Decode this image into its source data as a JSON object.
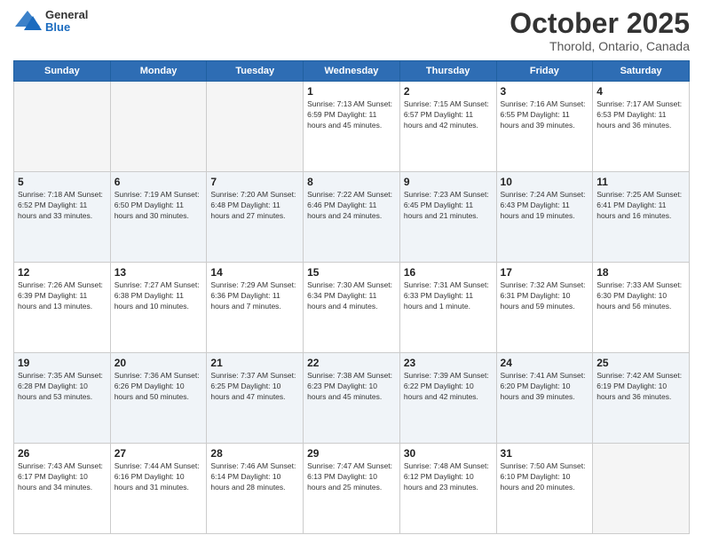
{
  "header": {
    "logo": {
      "general": "General",
      "blue": "Blue"
    },
    "title": "October 2025",
    "location": "Thorold, Ontario, Canada"
  },
  "days_of_week": [
    "Sunday",
    "Monday",
    "Tuesday",
    "Wednesday",
    "Thursday",
    "Friday",
    "Saturday"
  ],
  "weeks": [
    [
      {
        "day": "",
        "info": ""
      },
      {
        "day": "",
        "info": ""
      },
      {
        "day": "",
        "info": ""
      },
      {
        "day": "1",
        "info": "Sunrise: 7:13 AM\nSunset: 6:59 PM\nDaylight: 11 hours and 45 minutes."
      },
      {
        "day": "2",
        "info": "Sunrise: 7:15 AM\nSunset: 6:57 PM\nDaylight: 11 hours and 42 minutes."
      },
      {
        "day": "3",
        "info": "Sunrise: 7:16 AM\nSunset: 6:55 PM\nDaylight: 11 hours and 39 minutes."
      },
      {
        "day": "4",
        "info": "Sunrise: 7:17 AM\nSunset: 6:53 PM\nDaylight: 11 hours and 36 minutes."
      }
    ],
    [
      {
        "day": "5",
        "info": "Sunrise: 7:18 AM\nSunset: 6:52 PM\nDaylight: 11 hours and 33 minutes."
      },
      {
        "day": "6",
        "info": "Sunrise: 7:19 AM\nSunset: 6:50 PM\nDaylight: 11 hours and 30 minutes."
      },
      {
        "day": "7",
        "info": "Sunrise: 7:20 AM\nSunset: 6:48 PM\nDaylight: 11 hours and 27 minutes."
      },
      {
        "day": "8",
        "info": "Sunrise: 7:22 AM\nSunset: 6:46 PM\nDaylight: 11 hours and 24 minutes."
      },
      {
        "day": "9",
        "info": "Sunrise: 7:23 AM\nSunset: 6:45 PM\nDaylight: 11 hours and 21 minutes."
      },
      {
        "day": "10",
        "info": "Sunrise: 7:24 AM\nSunset: 6:43 PM\nDaylight: 11 hours and 19 minutes."
      },
      {
        "day": "11",
        "info": "Sunrise: 7:25 AM\nSunset: 6:41 PM\nDaylight: 11 hours and 16 minutes."
      }
    ],
    [
      {
        "day": "12",
        "info": "Sunrise: 7:26 AM\nSunset: 6:39 PM\nDaylight: 11 hours and 13 minutes."
      },
      {
        "day": "13",
        "info": "Sunrise: 7:27 AM\nSunset: 6:38 PM\nDaylight: 11 hours and 10 minutes."
      },
      {
        "day": "14",
        "info": "Sunrise: 7:29 AM\nSunset: 6:36 PM\nDaylight: 11 hours and 7 minutes."
      },
      {
        "day": "15",
        "info": "Sunrise: 7:30 AM\nSunset: 6:34 PM\nDaylight: 11 hours and 4 minutes."
      },
      {
        "day": "16",
        "info": "Sunrise: 7:31 AM\nSunset: 6:33 PM\nDaylight: 11 hours and 1 minute."
      },
      {
        "day": "17",
        "info": "Sunrise: 7:32 AM\nSunset: 6:31 PM\nDaylight: 10 hours and 59 minutes."
      },
      {
        "day": "18",
        "info": "Sunrise: 7:33 AM\nSunset: 6:30 PM\nDaylight: 10 hours and 56 minutes."
      }
    ],
    [
      {
        "day": "19",
        "info": "Sunrise: 7:35 AM\nSunset: 6:28 PM\nDaylight: 10 hours and 53 minutes."
      },
      {
        "day": "20",
        "info": "Sunrise: 7:36 AM\nSunset: 6:26 PM\nDaylight: 10 hours and 50 minutes."
      },
      {
        "day": "21",
        "info": "Sunrise: 7:37 AM\nSunset: 6:25 PM\nDaylight: 10 hours and 47 minutes."
      },
      {
        "day": "22",
        "info": "Sunrise: 7:38 AM\nSunset: 6:23 PM\nDaylight: 10 hours and 45 minutes."
      },
      {
        "day": "23",
        "info": "Sunrise: 7:39 AM\nSunset: 6:22 PM\nDaylight: 10 hours and 42 minutes."
      },
      {
        "day": "24",
        "info": "Sunrise: 7:41 AM\nSunset: 6:20 PM\nDaylight: 10 hours and 39 minutes."
      },
      {
        "day": "25",
        "info": "Sunrise: 7:42 AM\nSunset: 6:19 PM\nDaylight: 10 hours and 36 minutes."
      }
    ],
    [
      {
        "day": "26",
        "info": "Sunrise: 7:43 AM\nSunset: 6:17 PM\nDaylight: 10 hours and 34 minutes."
      },
      {
        "day": "27",
        "info": "Sunrise: 7:44 AM\nSunset: 6:16 PM\nDaylight: 10 hours and 31 minutes."
      },
      {
        "day": "28",
        "info": "Sunrise: 7:46 AM\nSunset: 6:14 PM\nDaylight: 10 hours and 28 minutes."
      },
      {
        "day": "29",
        "info": "Sunrise: 7:47 AM\nSunset: 6:13 PM\nDaylight: 10 hours and 25 minutes."
      },
      {
        "day": "30",
        "info": "Sunrise: 7:48 AM\nSunset: 6:12 PM\nDaylight: 10 hours and 23 minutes."
      },
      {
        "day": "31",
        "info": "Sunrise: 7:50 AM\nSunset: 6:10 PM\nDaylight: 10 hours and 20 minutes."
      },
      {
        "day": "",
        "info": ""
      }
    ]
  ]
}
